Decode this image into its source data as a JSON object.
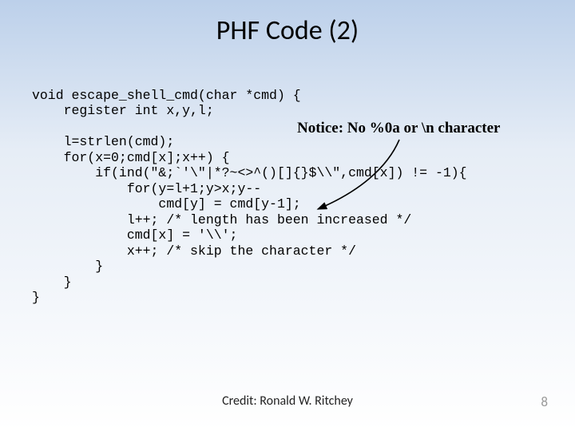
{
  "title": "PHF Code (2)",
  "notice": "Notice:  No %0a or \\n character",
  "code": "void escape_shell_cmd(char *cmd) {\n    register int x,y,l;\n\n    l=strlen(cmd);\n    for(x=0;cmd[x];x++) {\n        if(ind(\"&;`'\\\"|*?~<>^()[]{}$\\\\\",cmd[x]) != -1){\n            for(y=l+1;y>x;y--\n                cmd[y] = cmd[y-1];\n            l++; /* length has been increased */\n            cmd[x] = '\\\\';\n            x++; /* skip the character */\n        }\n    }\n}",
  "credit": "Credit: Ronald W. Ritchey",
  "page_number": "8"
}
